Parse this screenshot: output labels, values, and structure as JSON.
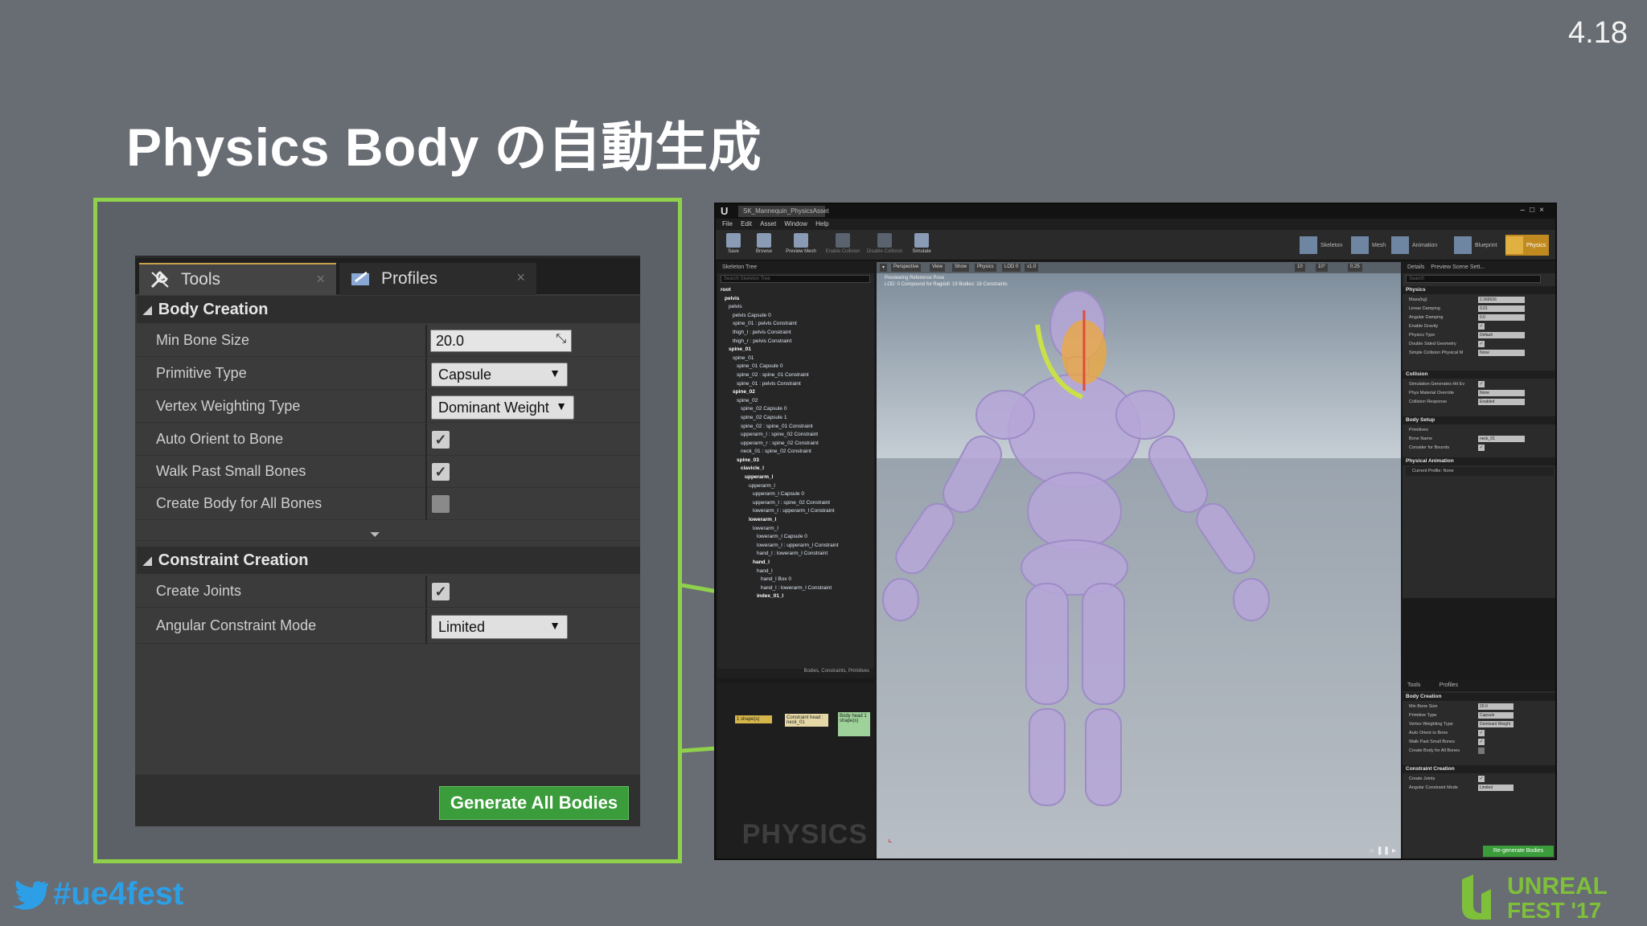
{
  "slide": {
    "version": "4.18",
    "title": "Physics Body の自動生成",
    "hashtag": "#ue4fest",
    "logo_line1": "UNREAL",
    "logo_line2": "FEST '17"
  },
  "zoom_panel": {
    "tabs": [
      {
        "label": "Tools",
        "active": true
      },
      {
        "label": "Profiles",
        "active": false
      }
    ],
    "body_creation": {
      "header": "Body Creation",
      "min_bone_size_label": "Min Bone Size",
      "min_bone_size_value": "20.0",
      "primitive_type_label": "Primitive Type",
      "primitive_type_value": "Capsule",
      "vertex_weighting_label": "Vertex Weighting Type",
      "vertex_weighting_value": "Dominant Weight",
      "auto_orient_label": "Auto Orient to Bone",
      "auto_orient_checked": true,
      "walk_past_label": "Walk Past Small Bones",
      "walk_past_checked": true,
      "create_all_label": "Create Body for All Bones",
      "create_all_checked": false
    },
    "constraint_creation": {
      "header": "Constraint Creation",
      "create_joints_label": "Create Joints",
      "create_joints_checked": true,
      "angular_mode_label": "Angular Constraint Mode",
      "angular_mode_value": "Limited"
    },
    "generate_button": "Generate All Bodies"
  },
  "editor": {
    "document_tab": "SK_Mannequin_PhysicsAsset",
    "menu": [
      "File",
      "Edit",
      "Asset",
      "Window",
      "Help"
    ],
    "toolbar": [
      "Save",
      "Browse",
      "Preview Mesh",
      "Enable Collision",
      "Disable Collision",
      "Simulate"
    ],
    "modes": [
      "Skeleton",
      "Mesh",
      "Animation",
      "Blueprint",
      "Physics"
    ],
    "skeleton_tree_tab": "Skeleton Tree",
    "skeleton_search_placeholder": "Search Skeleton Tree",
    "tree": [
      {
        "text": "root",
        "bold": true,
        "indent": 0
      },
      {
        "text": "pelvis",
        "bold": true,
        "indent": 1
      },
      {
        "text": "pelvis",
        "bold": false,
        "indent": 2
      },
      {
        "text": "pelvis Capsule 0",
        "bold": false,
        "indent": 3
      },
      {
        "text": "spine_01 : pelvis Constraint",
        "bold": false,
        "indent": 3
      },
      {
        "text": "thigh_l : pelvis Constraint",
        "bold": false,
        "indent": 3
      },
      {
        "text": "thigh_r : pelvis Constraint",
        "bold": false,
        "indent": 3
      },
      {
        "text": "spine_01",
        "bold": true,
        "indent": 2
      },
      {
        "text": "spine_01",
        "bold": false,
        "indent": 3
      },
      {
        "text": "spine_01 Capsule 0",
        "bold": false,
        "indent": 4
      },
      {
        "text": "spine_02 : spine_01 Constraint",
        "bold": false,
        "indent": 4
      },
      {
        "text": "spine_01 : pelvis Constraint",
        "bold": false,
        "indent": 4
      },
      {
        "text": "spine_02",
        "bold": true,
        "indent": 3
      },
      {
        "text": "spine_02",
        "bold": false,
        "indent": 4
      },
      {
        "text": "spine_02 Capsule 0",
        "bold": false,
        "indent": 5
      },
      {
        "text": "spine_02 Capsule 1",
        "bold": false,
        "indent": 5
      },
      {
        "text": "spine_02 : spine_01 Constraint",
        "bold": false,
        "indent": 5
      },
      {
        "text": "upperarm_l : spine_02 Constraint",
        "bold": false,
        "indent": 5
      },
      {
        "text": "upperarm_r : spine_02 Constraint",
        "bold": false,
        "indent": 5
      },
      {
        "text": "neck_01 : spine_02 Constraint",
        "bold": false,
        "indent": 5
      },
      {
        "text": "spine_03",
        "bold": true,
        "indent": 4
      },
      {
        "text": "clavicle_l",
        "bold": true,
        "indent": 5
      },
      {
        "text": "upperarm_l",
        "bold": true,
        "indent": 6
      },
      {
        "text": "upperarm_l",
        "bold": false,
        "indent": 7
      },
      {
        "text": "upperarm_l Capsule 0",
        "bold": false,
        "indent": 8
      },
      {
        "text": "upperarm_l : spine_02 Constraint",
        "bold": false,
        "indent": 8
      },
      {
        "text": "lowerarm_l : upperarm_l Constraint",
        "bold": false,
        "indent": 8
      },
      {
        "text": "lowerarm_l",
        "bold": true,
        "indent": 7
      },
      {
        "text": "lowerarm_l",
        "bold": false,
        "indent": 8
      },
      {
        "text": "lowerarm_l Capsule 0",
        "bold": false,
        "indent": 9
      },
      {
        "text": "lowerarm_l : upperarm_l Constraint",
        "bold": false,
        "indent": 9
      },
      {
        "text": "hand_l : lowerarm_l Constraint",
        "bold": false,
        "indent": 9
      },
      {
        "text": "hand_l",
        "bold": true,
        "indent": 8
      },
      {
        "text": "hand_l",
        "bold": false,
        "indent": 9
      },
      {
        "text": "hand_l Box 0",
        "bold": false,
        "indent": 10
      },
      {
        "text": "hand_l : lowerarm_l Constraint",
        "bold": false,
        "indent": 10
      },
      {
        "text": "index_01_l",
        "bold": true,
        "indent": 9
      }
    ],
    "skeleton_footer": "Bodies, Constraints, Primitives",
    "graph_nodes": [
      "1 shape(s)",
      "Constraint head : neck_01",
      "Body head 1 shape(s)"
    ],
    "graph_watermark": "PHYSICS",
    "viewport_chips": [
      "Perspective",
      "View",
      "Show",
      "Physics",
      "LOD 0",
      "x1.0"
    ],
    "viewport_snap_values": [
      "10",
      "10°",
      "0.25"
    ],
    "viewport_info": [
      "Previewing Reference Pose",
      "LOD: 0 Compound for Ragdoll: 19 Bodies: 18 Constraints"
    ],
    "details_tab": "Details",
    "preview_tab": "Preview Scene Sett...",
    "details_search_placeholder": "Search",
    "physics_section": "Physics",
    "physics_rows": [
      {
        "label": "Mass(kg)",
        "value": "2.366636"
      },
      {
        "label": "Linear Damping",
        "value": "0.01"
      },
      {
        "label": "Angular Damping",
        "value": "0.0"
      },
      {
        "label": "Enable Gravity",
        "value": "check"
      },
      {
        "label": "Physics Type",
        "value": "Default"
      },
      {
        "label": "Double Sided Geometry",
        "value": "check"
      },
      {
        "label": "Simple Collision Physical M",
        "value": "None"
      }
    ],
    "collision_section": "Collision",
    "collision_rows": [
      {
        "label": "Simulation Generates Hit Ev",
        "value": "check"
      },
      {
        "label": "Phys Material Override",
        "value": "None"
      },
      {
        "label": "Collision Response",
        "value": "Enabled"
      }
    ],
    "body_setup_section": "Body Setup",
    "body_setup_rows": [
      {
        "label": "Primitives",
        "value": ""
      },
      {
        "label": "Bone Name",
        "value": "neck_01"
      },
      {
        "label": "Consider for Bounds",
        "value": "check"
      }
    ],
    "physical_animation_section": "Physical Animation",
    "current_profile": "Current Profile: None",
    "mini_tabs": [
      "Tools",
      "Profiles"
    ],
    "mini_body_creation": "Body Creation",
    "mini_rows": [
      {
        "label": "Min Bone Size",
        "value": "20.0"
      },
      {
        "label": "Primitive Type",
        "value": "Capsule"
      },
      {
        "label": "Vertex Weighting Type",
        "value": "Dominant Weight"
      },
      {
        "label": "Auto Orient to Bone",
        "value": "check"
      },
      {
        "label": "Walk Past Small Bones",
        "value": "check"
      },
      {
        "label": "Create Body for All Bones",
        "value": "box"
      }
    ],
    "mini_constraint_creation": "Constraint Creation",
    "mini_constraint_rows": [
      {
        "label": "Create Joints",
        "value": "check"
      },
      {
        "label": "Angular Constraint Mode",
        "value": "Limited"
      }
    ],
    "regenerate_button": "Re-generate Bodies"
  },
  "colors": {
    "background": "#686c73",
    "callout_green": "#8fd14a",
    "button_green": "#3a9c3a",
    "twitter_blue": "#2d9fe6",
    "logo_green": "#7fc03a"
  },
  "icons": [
    "wrench-icon",
    "profiles-icon",
    "checkbox-check-icon",
    "dropdown-caret-icon",
    "twitter-bird-icon"
  ]
}
